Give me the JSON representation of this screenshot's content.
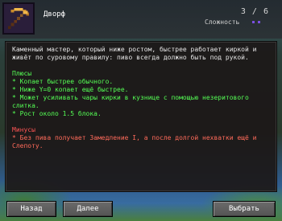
{
  "header": {
    "title": "Дворф",
    "counter": "3 / 6",
    "difficulty_label": "Сложность",
    "difficulty_level": 2,
    "icon": "pickaxe-icon"
  },
  "description": "Каменный мастер, который ниже ростом, быстрее работает киркой и живёт по суровому правилу: пиво всегда должно быть под рукой.",
  "pros": {
    "heading": "Плюсы",
    "items": [
      "* Копает быстрее обычного.",
      "* Ниже Y=0 копает ещё быстрее.",
      "* Может усиливать чары кирки в кузнице с помощью незеритового слитка.",
      "* Рост около 1.5 блока."
    ]
  },
  "cons": {
    "heading": "Минусы",
    "items": [
      "* Без пива получает Замедление I, а после долгой нехватки ещё и Слепоту."
    ]
  },
  "buttons": {
    "back": "Назад",
    "next": "Далее",
    "select": "Выбрать"
  },
  "colors": {
    "pros": "#55ff55",
    "cons": "#ff5555",
    "difficulty_dot": "#7a4fe0"
  }
}
